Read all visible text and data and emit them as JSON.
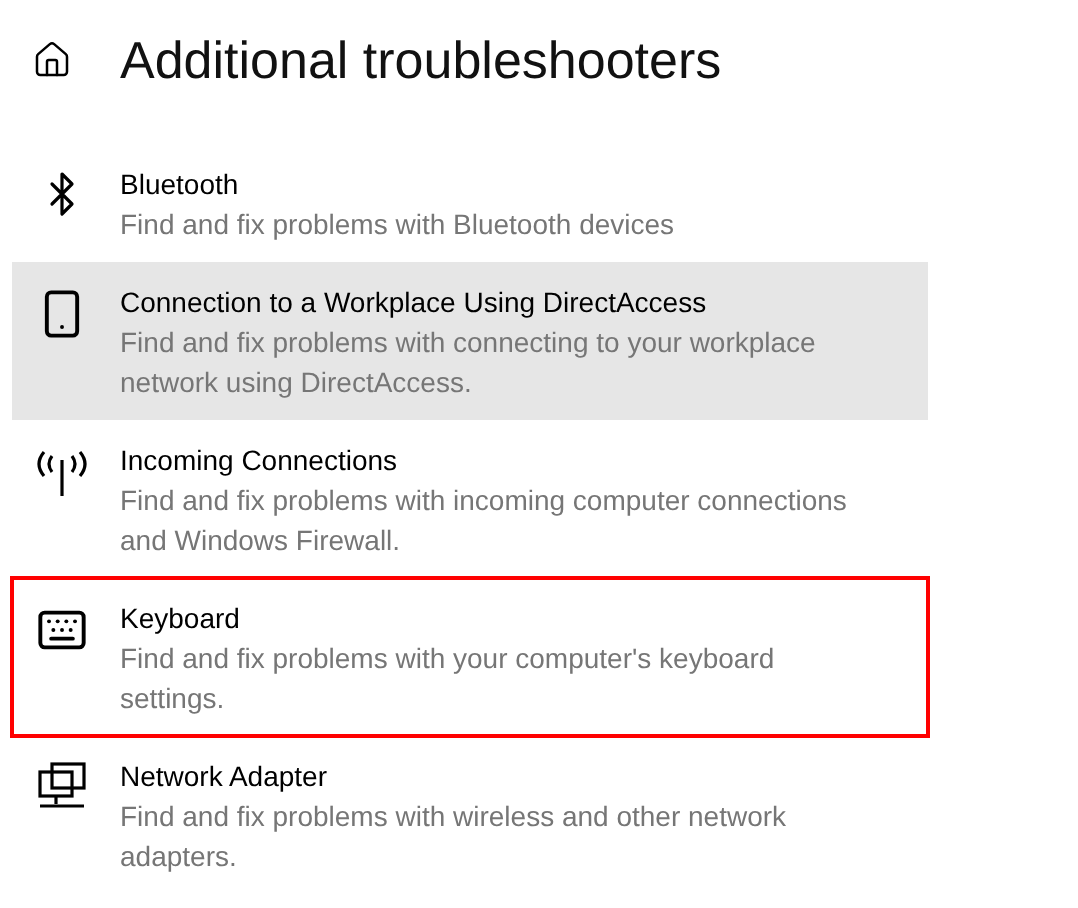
{
  "header": {
    "title": "Additional troubleshooters"
  },
  "items": [
    {
      "kind": "bluetooth",
      "name": "Bluetooth",
      "description": "Find and fix problems with Bluetooth devices",
      "hovered": false,
      "outlined": false
    },
    {
      "kind": "phone",
      "name": "Connection to a Workplace Using DirectAccess",
      "description": "Find and fix problems with connecting to your workplace network using DirectAccess.",
      "hovered": true,
      "outlined": false
    },
    {
      "kind": "antenna",
      "name": "Incoming Connections",
      "description": "Find and fix problems with incoming computer connections and Windows Firewall.",
      "hovered": false,
      "outlined": false
    },
    {
      "kind": "keyboard",
      "name": "Keyboard",
      "description": "Find and fix problems with your computer's keyboard settings.",
      "hovered": false,
      "outlined": true
    },
    {
      "kind": "network",
      "name": "Network Adapter",
      "description": "Find and fix problems with wireless and other network adapters.",
      "hovered": false,
      "outlined": false
    }
  ]
}
